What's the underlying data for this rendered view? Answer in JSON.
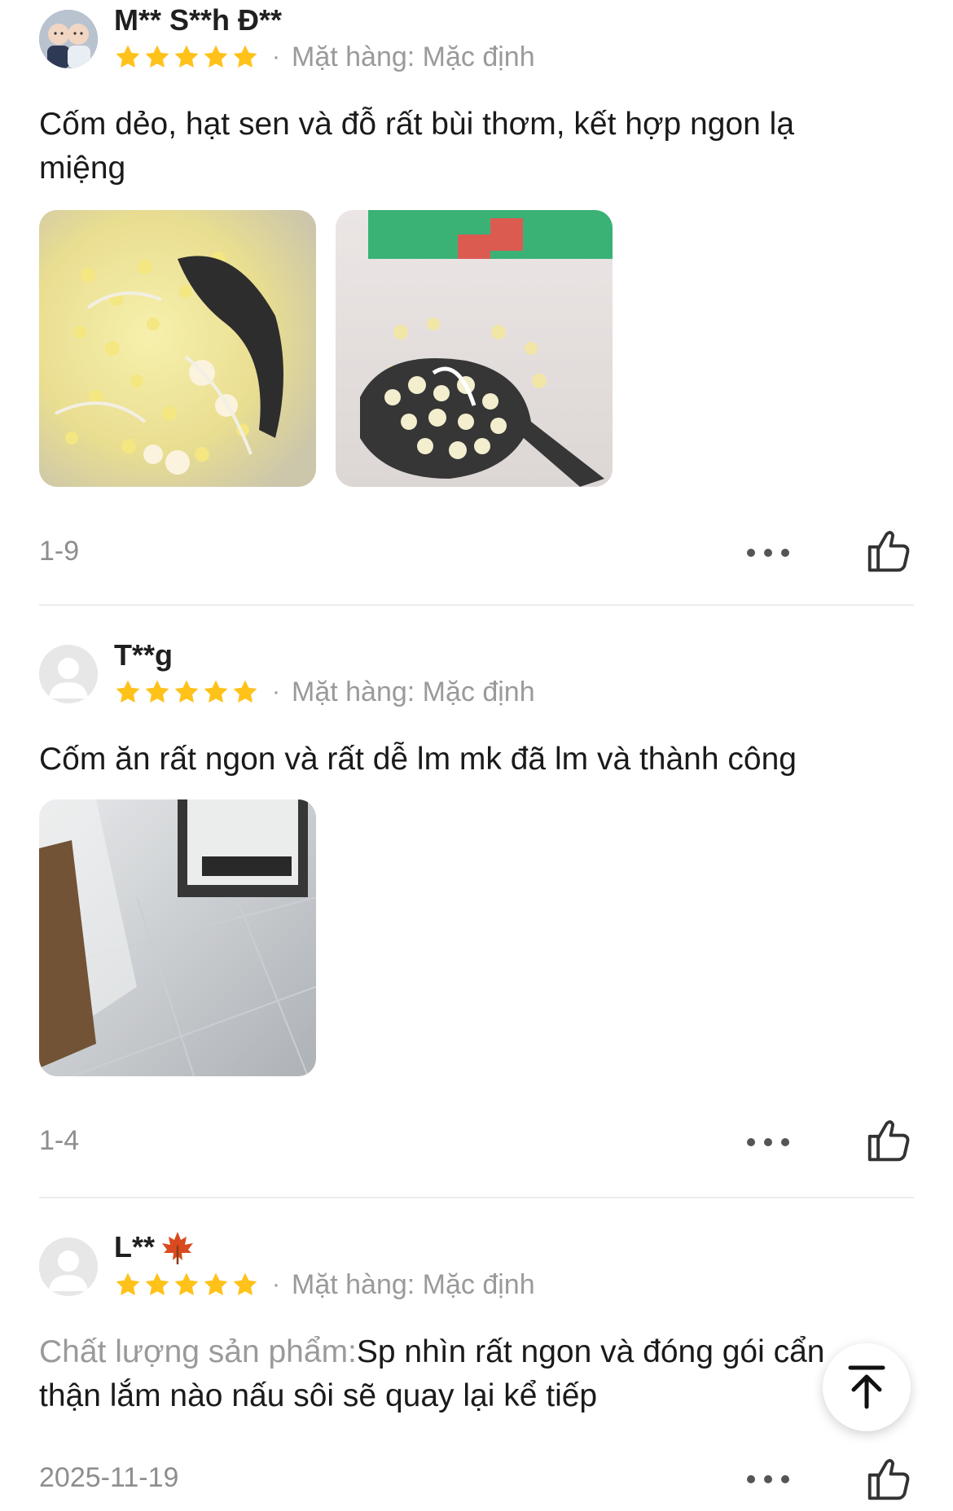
{
  "reviews": [
    {
      "username": "M** S**h Đ**",
      "rating": 5,
      "variant": "Mặt hàng: Mặc định",
      "text": "Cốm dẻo, hạt sen và đỗ rất bùi thơm, kết hợp ngon lạ miệng",
      "date": "1-9",
      "avatar": "baby-photo",
      "photos": [
        "food-photo-bag-spoon",
        "food-photo-spoonful"
      ]
    },
    {
      "username": "T**g",
      "rating": 5,
      "variant": "Mặt hàng: Mặc định",
      "text": "Cốm ăn rất ngon và rất dễ lm mk đã lm và thành công",
      "date": "1-4",
      "avatar": "default-user-icon",
      "photos": [
        "floor-photo"
      ]
    },
    {
      "username": "L**",
      "username_emoji": "maple-leaf-icon",
      "rating": 5,
      "variant": "Mặt hàng: Mặc định",
      "text_prefix": "Chất lượng sản phẩm:",
      "text": "Sp nhìn rất ngon và đóng gói cẩn thận lắm nào nấu sôi sẽ quay lại kể tiếp",
      "date": "2025-11-19",
      "avatar": "default-user-icon"
    }
  ],
  "colors": {
    "star": "#ffc21a",
    "muted_text": "#9a9a9a",
    "divider": "#ececec"
  },
  "icons": {
    "more": "more-dots-icon",
    "like": "thumbs-up-icon",
    "scroll_top": "arrow-up-to-top-icon"
  }
}
